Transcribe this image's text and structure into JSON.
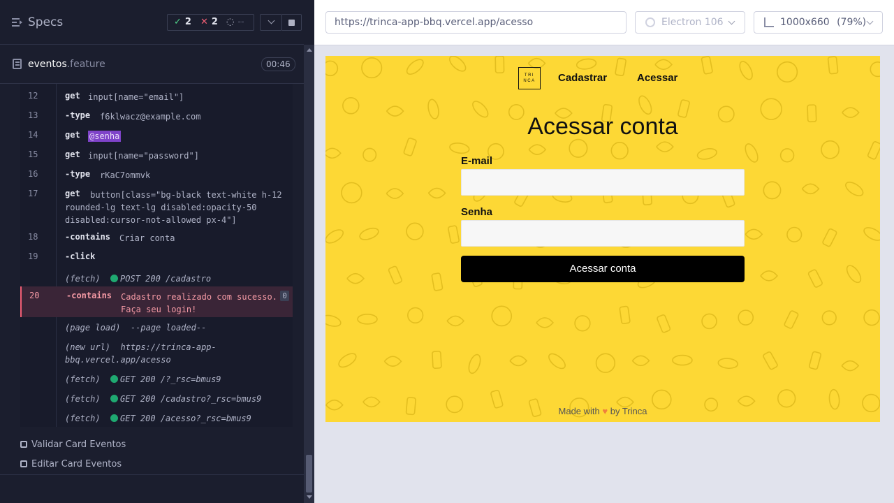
{
  "specs_panel": {
    "title": "Specs",
    "stats": {
      "passed": "2",
      "failed": "2",
      "pending": "--"
    },
    "file": {
      "name": "eventos",
      "ext": ".feature",
      "duration": "00:46"
    }
  },
  "command_log": [
    {
      "num": "12",
      "kw": "get",
      "arg": "input[name=\"email\"]"
    },
    {
      "num": "13",
      "kw": "-type",
      "arg": "f6klwacz@example.com"
    },
    {
      "num": "14",
      "kw": "get",
      "alias": "@senha"
    },
    {
      "num": "15",
      "kw": "get",
      "arg": "input[name=\"password\"]"
    },
    {
      "num": "16",
      "kw": "-type",
      "arg": "rKaC7ommvk"
    },
    {
      "num": "17",
      "kw": "get",
      "arg": "button[class=\"bg-black text-white h-12\nrounded-lg text-lg disabled:opacity-50\ndisabled:cursor-not-allowed px-4\"]"
    },
    {
      "num": "18",
      "kw": "-contains",
      "arg": "Criar conta"
    },
    {
      "num": "19",
      "kw": "-click",
      "arg": ""
    },
    {
      "event": "(fetch)",
      "status": "POST 200 /cadastro"
    },
    {
      "num": "20",
      "kw": "-contains",
      "arg": "Cadastro realizado com sucesso.\nFaça seu login!",
      "badge": "0"
    },
    {
      "event": "(page load)",
      "status": "--page loaded--"
    },
    {
      "event": "(new url)",
      "status": "https://trinca-app-\nbbq.vercel.app/acesso"
    },
    {
      "event": "(fetch)",
      "status": "GET 200 /?_rsc=bmus9"
    },
    {
      "event": "(fetch)",
      "status": "GET 200 /cadastro?_rsc=bmus9"
    },
    {
      "event": "(fetch)",
      "status": "GET 200 /acesso?_rsc=bmus9"
    }
  ],
  "suites": [
    "Validar Card Eventos",
    "Editar Card Eventos"
  ],
  "browser": {
    "url": "https://trinca-app-bbq.vercel.app/acesso",
    "engine": "Electron 106",
    "viewport": "1000x660",
    "zoom": "(79%)"
  },
  "app": {
    "logo_text": "TRI\nNCA",
    "nav": [
      "Cadastrar",
      "Acessar"
    ],
    "title": "Acessar conta",
    "email_label": "E-mail",
    "password_label": "Senha",
    "submit": "Acessar conta",
    "footer_prefix": "Made with",
    "footer_suffix": "by Trinca",
    "colors": {
      "background": "#fdd835",
      "button": "#000000"
    }
  }
}
